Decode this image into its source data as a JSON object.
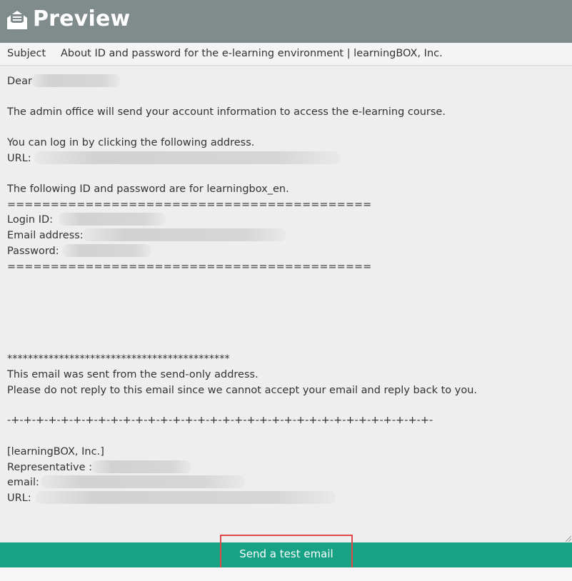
{
  "header": {
    "title": "Preview",
    "icon": "open-envelope-icon"
  },
  "subject": {
    "label": "Subject",
    "value": "About ID and password for the e-learning environment | learningBOX, Inc."
  },
  "email_body": {
    "greeting": "Dear",
    "intro": "The admin office will send your account information to access the e-learning course.",
    "login_line": "You can log in by clicking the following address.",
    "url_label": "URL:",
    "id_intro": "The following ID and password are for learningbox_en.",
    "separator": "==========================================",
    "login_id_label": "Login ID:",
    "email_label": "Email address:",
    "password_label": "Password:",
    "star_line": "*******************************************",
    "send_only": "This email was sent from the send-only address.",
    "no_reply": "Please do not reply to this email since we cannot accept your email and reply back to you.",
    "dash_line": "-+-+-+-+-+-+-+-+-+-+-+-+-+-+-+-+-+-+-+-+-+-+-+-+-+-+-+-+-+-+-+-+-+-+-",
    "company": "[learningBOX, Inc.]",
    "representative_label": "Representative :",
    "sig_email_label": "email:",
    "sig_url_label": "URL:"
  },
  "footer": {
    "send_button": "Send a test email"
  },
  "colors": {
    "header_bg": "#808b8b",
    "footer_bg": "#17a185",
    "highlight": "#e04848"
  }
}
